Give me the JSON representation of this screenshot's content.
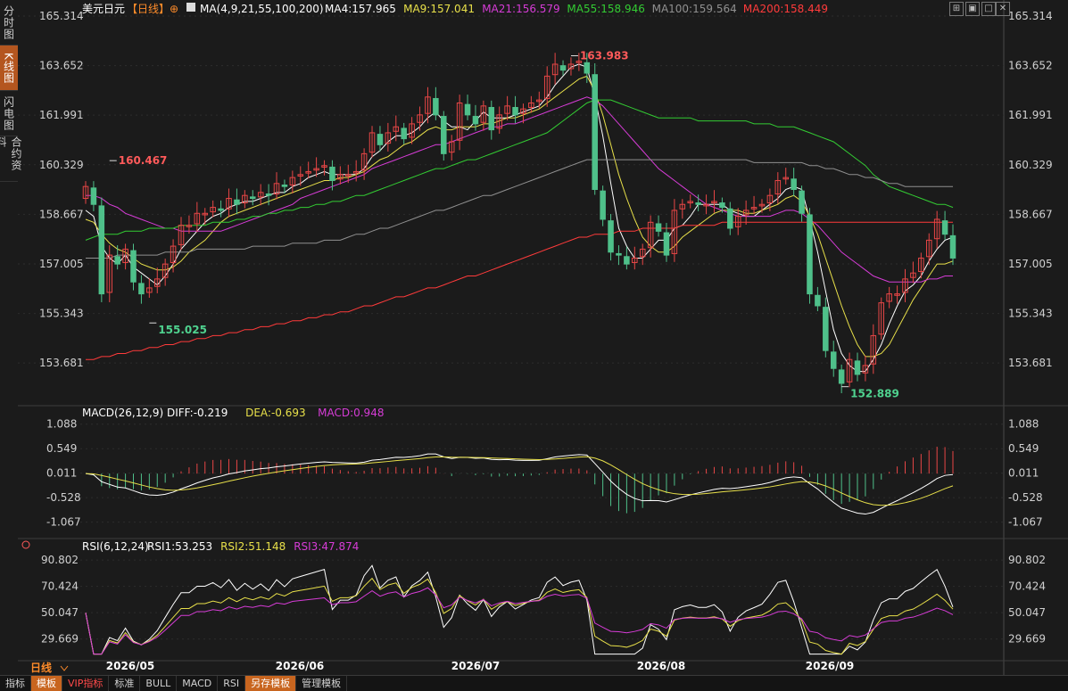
{
  "side_tabs": [
    "分时图",
    "K线图",
    "闪电图",
    "合约资料"
  ],
  "header": {
    "symbol": "美元日元",
    "period": "【日线】",
    "ma_params": "MA(4,9,21,55,100,200)",
    "ma_values": [
      {
        "label": "MA4:157.965",
        "color": "#ffffff"
      },
      {
        "label": "MA9:157.041",
        "color": "#e8e04a"
      },
      {
        "label": "MA21:156.579",
        "color": "#d63cd6"
      },
      {
        "label": "MA55:158.946",
        "color": "#33cc33"
      },
      {
        "label": "MA100:159.564",
        "color": "#909090"
      },
      {
        "label": "MA200:158.449",
        "color": "#ff3b3b"
      }
    ]
  },
  "period_label": "日线",
  "bottom_tabs": [
    "指标",
    "模板",
    "VIP指标",
    "标准",
    "BULL",
    "MACD",
    "RSI",
    "另存模板",
    "管理模板"
  ],
  "icons": [
    "grid-icon",
    "restore-icon",
    "maximize-icon",
    "close-icon"
  ],
  "chart_data": {
    "type": "candlestick",
    "price_axis_labels": [
      "165.314",
      "163.652",
      "161.991",
      "160.329",
      "158.667",
      "157.005",
      "155.343",
      "153.681"
    ],
    "price_ylim": [
      152.7,
      165.314
    ],
    "x_labels": [
      "2026/05",
      "2026/06",
      "2026/07",
      "2026/08",
      "2026/09"
    ],
    "annotations": [
      {
        "text": "160.467",
        "value": 160.467,
        "kind": "high"
      },
      {
        "text": "155.025",
        "value": 155.025,
        "kind": "low"
      },
      {
        "text": "163.983",
        "value": 163.983,
        "kind": "high"
      },
      {
        "text": "152.889",
        "value": 152.889,
        "kind": "low"
      }
    ],
    "closes": [
      159.6,
      159.0,
      156.0,
      157.3,
      157.0,
      157.5,
      156.4,
      156.0,
      156.2,
      156.5,
      157.0,
      157.6,
      158.3,
      158.3,
      158.7,
      158.7,
      158.9,
      158.8,
      159.2,
      159.0,
      159.3,
      159.2,
      159.4,
      159.3,
      159.7,
      159.6,
      159.9,
      160.0,
      160.1,
      160.2,
      160.3,
      159.8,
      160.0,
      160.0,
      160.1,
      160.7,
      161.4,
      161.0,
      161.4,
      161.6,
      161.2,
      161.7,
      162.0,
      162.6,
      162.0,
      160.7,
      161.1,
      162.4,
      162.0,
      161.7,
      162.3,
      161.5,
      162.0,
      162.3,
      162.0,
      162.2,
      162.4,
      162.5,
      163.3,
      163.7,
      163.5,
      163.7,
      163.8,
      163.4,
      159.5,
      158.5,
      157.4,
      157.3,
      157.0,
      157.2,
      157.5,
      158.4,
      158.1,
      157.3,
      158.8,
      159.0,
      159.1,
      159.0,
      159.0,
      159.1,
      158.9,
      158.2,
      158.6,
      158.8,
      158.9,
      159.0,
      159.3,
      159.8,
      159.9,
      159.5,
      158.7,
      156.0,
      155.6,
      154.1,
      153.5,
      153.0,
      153.8,
      153.3,
      153.6,
      154.6,
      155.7,
      156.0,
      156.0,
      156.5,
      156.7,
      157.2,
      157.8,
      158.5,
      158.0,
      157.2
    ],
    "moving_averages": {
      "MA4": [
        158.8,
        158.6,
        157.6,
        157.2,
        157.0,
        157.3,
        156.9,
        156.7,
        156.5,
        156.3,
        156.6,
        157.0,
        157.5,
        157.8,
        158.1,
        158.4,
        158.6,
        158.7,
        158.9,
        159.0,
        159.1,
        159.1,
        159.2,
        159.3,
        159.4,
        159.4,
        159.6,
        159.7,
        159.9,
        160.0,
        160.1,
        160.0,
        160.0,
        160.0,
        160.0,
        160.2,
        160.6,
        160.8,
        161.1,
        161.3,
        161.3,
        161.4,
        161.6,
        161.9,
        162.1,
        161.8,
        161.6,
        161.6,
        161.5,
        161.8,
        162.1,
        161.9,
        161.9,
        161.9,
        162.0,
        162.1,
        162.2,
        162.3,
        162.6,
        163.0,
        163.3,
        163.6,
        163.7,
        163.6,
        162.6,
        161.3,
        159.7,
        158.2,
        157.6,
        157.2,
        157.2,
        157.5,
        157.8,
        157.8,
        158.2,
        158.3,
        158.6,
        159.0,
        159.0,
        159.0,
        159.0,
        158.8,
        158.7,
        158.6,
        158.6,
        158.8,
        159.0,
        159.2,
        159.5,
        159.6,
        159.5,
        158.5,
        157.4,
        156.1,
        154.8,
        154.0,
        153.6,
        153.4,
        153.4,
        153.8,
        154.3,
        155.0,
        155.6,
        156.1,
        156.3,
        156.6,
        157.1,
        157.5,
        157.8,
        157.9
      ],
      "MA9": [
        158.5,
        158.4,
        158.0,
        157.7,
        157.5,
        157.4,
        157.2,
        157.0,
        156.9,
        156.8,
        156.8,
        156.9,
        157.1,
        157.4,
        157.6,
        157.8,
        158.1,
        158.4,
        158.6,
        158.7,
        158.8,
        158.9,
        159.0,
        159.1,
        159.2,
        159.3,
        159.4,
        159.5,
        159.6,
        159.7,
        159.8,
        159.8,
        159.9,
        159.9,
        160.0,
        160.1,
        160.3,
        160.5,
        160.6,
        160.8,
        161.0,
        161.1,
        161.3,
        161.5,
        161.6,
        161.5,
        161.5,
        161.6,
        161.6,
        161.6,
        161.7,
        161.7,
        161.8,
        161.9,
        161.9,
        162.0,
        162.1,
        162.2,
        162.4,
        162.6,
        162.8,
        163.0,
        163.2,
        163.3,
        162.8,
        162.0,
        161.0,
        160.0,
        159.2,
        158.5,
        157.9,
        157.6,
        157.4,
        157.4,
        157.6,
        157.9,
        158.1,
        158.3,
        158.5,
        158.7,
        158.8,
        158.8,
        158.8,
        158.7,
        158.7,
        158.8,
        158.9,
        159.0,
        159.2,
        159.3,
        159.1,
        158.6,
        158.0,
        157.2,
        156.4,
        155.6,
        154.9,
        154.3,
        153.9,
        153.9,
        154.0,
        154.3,
        154.8,
        155.3,
        155.8,
        156.2,
        156.6,
        157.0,
        157.0,
        157.1
      ],
      "MA21": [
        159.3,
        159.3,
        159.2,
        159.0,
        158.9,
        158.7,
        158.6,
        158.5,
        158.4,
        158.3,
        158.2,
        158.2,
        158.1,
        158.1,
        158.1,
        158.1,
        158.1,
        158.1,
        158.2,
        158.3,
        158.4,
        158.5,
        158.6,
        158.7,
        158.8,
        158.9,
        159.0,
        159.2,
        159.3,
        159.4,
        159.5,
        159.6,
        159.7,
        159.8,
        159.9,
        160.0,
        160.2,
        160.3,
        160.4,
        160.5,
        160.6,
        160.7,
        160.8,
        160.9,
        161.0,
        161.0,
        161.1,
        161.2,
        161.3,
        161.4,
        161.5,
        161.6,
        161.6,
        161.7,
        161.7,
        161.8,
        161.9,
        162.0,
        162.1,
        162.2,
        162.3,
        162.4,
        162.5,
        162.6,
        162.5,
        162.3,
        162.0,
        161.7,
        161.4,
        161.1,
        160.8,
        160.5,
        160.2,
        160.0,
        159.8,
        159.6,
        159.4,
        159.2,
        159.0,
        158.9,
        158.8,
        158.7,
        158.6,
        158.6,
        158.6,
        158.6,
        158.6,
        158.7,
        158.8,
        158.8,
        158.7,
        158.5,
        158.3,
        158.0,
        157.7,
        157.4,
        157.2,
        157.0,
        156.8,
        156.6,
        156.5,
        156.4,
        156.4,
        156.4,
        156.4,
        156.4,
        156.5,
        156.5,
        156.6,
        156.6
      ],
      "MA55": [
        157.8,
        157.9,
        158.0,
        158.0,
        158.0,
        158.1,
        158.1,
        158.1,
        158.2,
        158.2,
        158.2,
        158.2,
        158.3,
        158.3,
        158.3,
        158.3,
        158.4,
        158.4,
        158.4,
        158.5,
        158.5,
        158.6,
        158.6,
        158.7,
        158.7,
        158.8,
        158.8,
        158.9,
        158.9,
        159.0,
        159.0,
        159.1,
        159.1,
        159.2,
        159.3,
        159.3,
        159.4,
        159.5,
        159.6,
        159.7,
        159.8,
        159.9,
        160.0,
        160.1,
        160.2,
        160.2,
        160.3,
        160.4,
        160.5,
        160.5,
        160.6,
        160.7,
        160.8,
        160.9,
        161.0,
        161.1,
        161.2,
        161.3,
        161.4,
        161.6,
        161.8,
        162.0,
        162.2,
        162.4,
        162.5,
        162.5,
        162.5,
        162.4,
        162.3,
        162.2,
        162.1,
        162.0,
        161.9,
        161.9,
        161.9,
        161.9,
        161.9,
        161.8,
        161.8,
        161.8,
        161.8,
        161.8,
        161.8,
        161.8,
        161.7,
        161.7,
        161.7,
        161.6,
        161.6,
        161.6,
        161.5,
        161.4,
        161.3,
        161.2,
        161.1,
        160.9,
        160.7,
        160.5,
        160.3,
        160.0,
        159.8,
        159.6,
        159.5,
        159.4,
        159.3,
        159.2,
        159.1,
        159.0,
        159.0,
        158.9
      ],
      "MA100": [
        157.2,
        157.2,
        157.2,
        157.2,
        157.3,
        157.3,
        157.3,
        157.3,
        157.3,
        157.3,
        157.4,
        157.4,
        157.4,
        157.4,
        157.5,
        157.5,
        157.5,
        157.5,
        157.5,
        157.5,
        157.5,
        157.6,
        157.6,
        157.6,
        157.6,
        157.6,
        157.7,
        157.7,
        157.7,
        157.7,
        157.8,
        157.8,
        157.8,
        157.9,
        158.0,
        158.0,
        158.1,
        158.2,
        158.2,
        158.3,
        158.4,
        158.5,
        158.6,
        158.7,
        158.8,
        158.8,
        158.9,
        159.0,
        159.1,
        159.2,
        159.3,
        159.3,
        159.4,
        159.5,
        159.6,
        159.7,
        159.8,
        159.9,
        160.0,
        160.1,
        160.2,
        160.3,
        160.4,
        160.5,
        160.5,
        160.5,
        160.5,
        160.5,
        160.5,
        160.5,
        160.5,
        160.5,
        160.5,
        160.5,
        160.5,
        160.5,
        160.5,
        160.5,
        160.5,
        160.5,
        160.5,
        160.5,
        160.5,
        160.5,
        160.4,
        160.4,
        160.4,
        160.4,
        160.4,
        160.4,
        160.4,
        160.3,
        160.3,
        160.2,
        160.2,
        160.1,
        160.0,
        160.0,
        159.9,
        159.9,
        159.8,
        159.7,
        159.7,
        159.6,
        159.6,
        159.6,
        159.6,
        159.6,
        159.6,
        159.6
      ],
      "MA200": [
        153.8,
        153.8,
        153.9,
        153.9,
        154.0,
        154.0,
        154.1,
        154.1,
        154.2,
        154.2,
        154.3,
        154.3,
        154.4,
        154.4,
        154.5,
        154.5,
        154.6,
        154.6,
        154.7,
        154.7,
        154.8,
        154.8,
        154.9,
        154.9,
        155.0,
        155.0,
        155.1,
        155.1,
        155.2,
        155.2,
        155.3,
        155.3,
        155.4,
        155.4,
        155.5,
        155.6,
        155.6,
        155.7,
        155.8,
        155.9,
        155.9,
        156.0,
        156.1,
        156.2,
        156.2,
        156.3,
        156.4,
        156.5,
        156.6,
        156.6,
        156.7,
        156.8,
        156.9,
        157.0,
        157.1,
        157.2,
        157.3,
        157.4,
        157.5,
        157.6,
        157.7,
        157.8,
        157.9,
        157.9,
        158.0,
        158.0,
        158.0,
        158.1,
        158.1,
        158.1,
        158.2,
        158.2,
        158.2,
        158.2,
        158.2,
        158.3,
        158.3,
        158.3,
        158.3,
        158.3,
        158.4,
        158.4,
        158.4,
        158.4,
        158.4,
        158.4,
        158.4,
        158.4,
        158.4,
        158.4,
        158.4,
        158.4,
        158.4,
        158.4,
        158.4,
        158.4,
        158.4,
        158.4,
        158.4,
        158.4,
        158.4,
        158.4,
        158.4,
        158.4,
        158.4,
        158.4,
        158.4,
        158.4,
        158.4,
        158.4
      ]
    },
    "macd": {
      "title": "MACD(26,12,9)",
      "values_text": [
        {
          "label": "DIFF:-0.219",
          "color": "#ffffff"
        },
        {
          "label": "DEA:-0.693",
          "color": "#e8e04a"
        },
        {
          "label": "MACD:0.948",
          "color": "#d63cd6"
        }
      ],
      "axis_labels": [
        "1.088",
        "0.549",
        "0.011",
        "-0.528",
        "-1.067"
      ],
      "ylim": [
        -1.35,
        1.2
      ]
    },
    "rsi": {
      "title": "RSI(6,12,24)",
      "values_text": [
        {
          "label": "RSI1:53.253",
          "color": "#ffffff"
        },
        {
          "label": "RSI2:51.148",
          "color": "#e8e04a"
        },
        {
          "label": "RSI3:47.874",
          "color": "#d63cd6"
        }
      ],
      "axis_labels": [
        "90.802",
        "70.424",
        "50.047",
        "29.669"
      ],
      "ylim": [
        15,
        95
      ]
    }
  }
}
